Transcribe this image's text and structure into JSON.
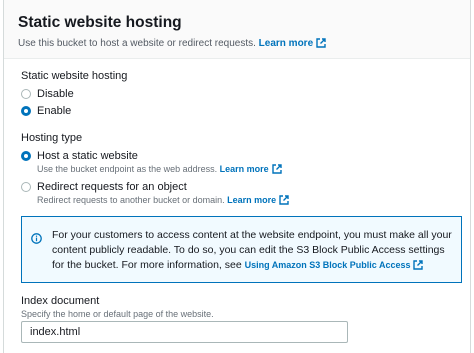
{
  "header": {
    "title": "Static website hosting",
    "description": "Use this bucket to host a website or redirect requests.",
    "learn_more": "Learn more"
  },
  "hosting": {
    "label": "Static website hosting",
    "options": [
      {
        "label": "Disable",
        "selected": false
      },
      {
        "label": "Enable",
        "selected": true
      }
    ]
  },
  "hosting_type": {
    "label": "Hosting type",
    "options": [
      {
        "label": "Host a static website",
        "description": "Use the bucket endpoint as the web address.",
        "learn_more": "Learn more",
        "selected": true
      },
      {
        "label": "Redirect requests for an object",
        "description": "Redirect requests to another bucket or domain.",
        "learn_more": "Learn more",
        "selected": false
      }
    ]
  },
  "info_alert": {
    "text": "For your customers to access content at the website endpoint, you must make all your content publicly readable. To do so, you can edit the S3 Block Public Access settings for the bucket. For more information, see",
    "link": "Using Amazon S3 Block Public Access"
  },
  "index_document": {
    "label": "Index document",
    "description": "Specify the home or default page of the website.",
    "value": "index.html"
  },
  "colors": {
    "accent": "#0073bb",
    "info_bg": "#f1faff",
    "text": "#16191f",
    "muted": "#687078"
  }
}
